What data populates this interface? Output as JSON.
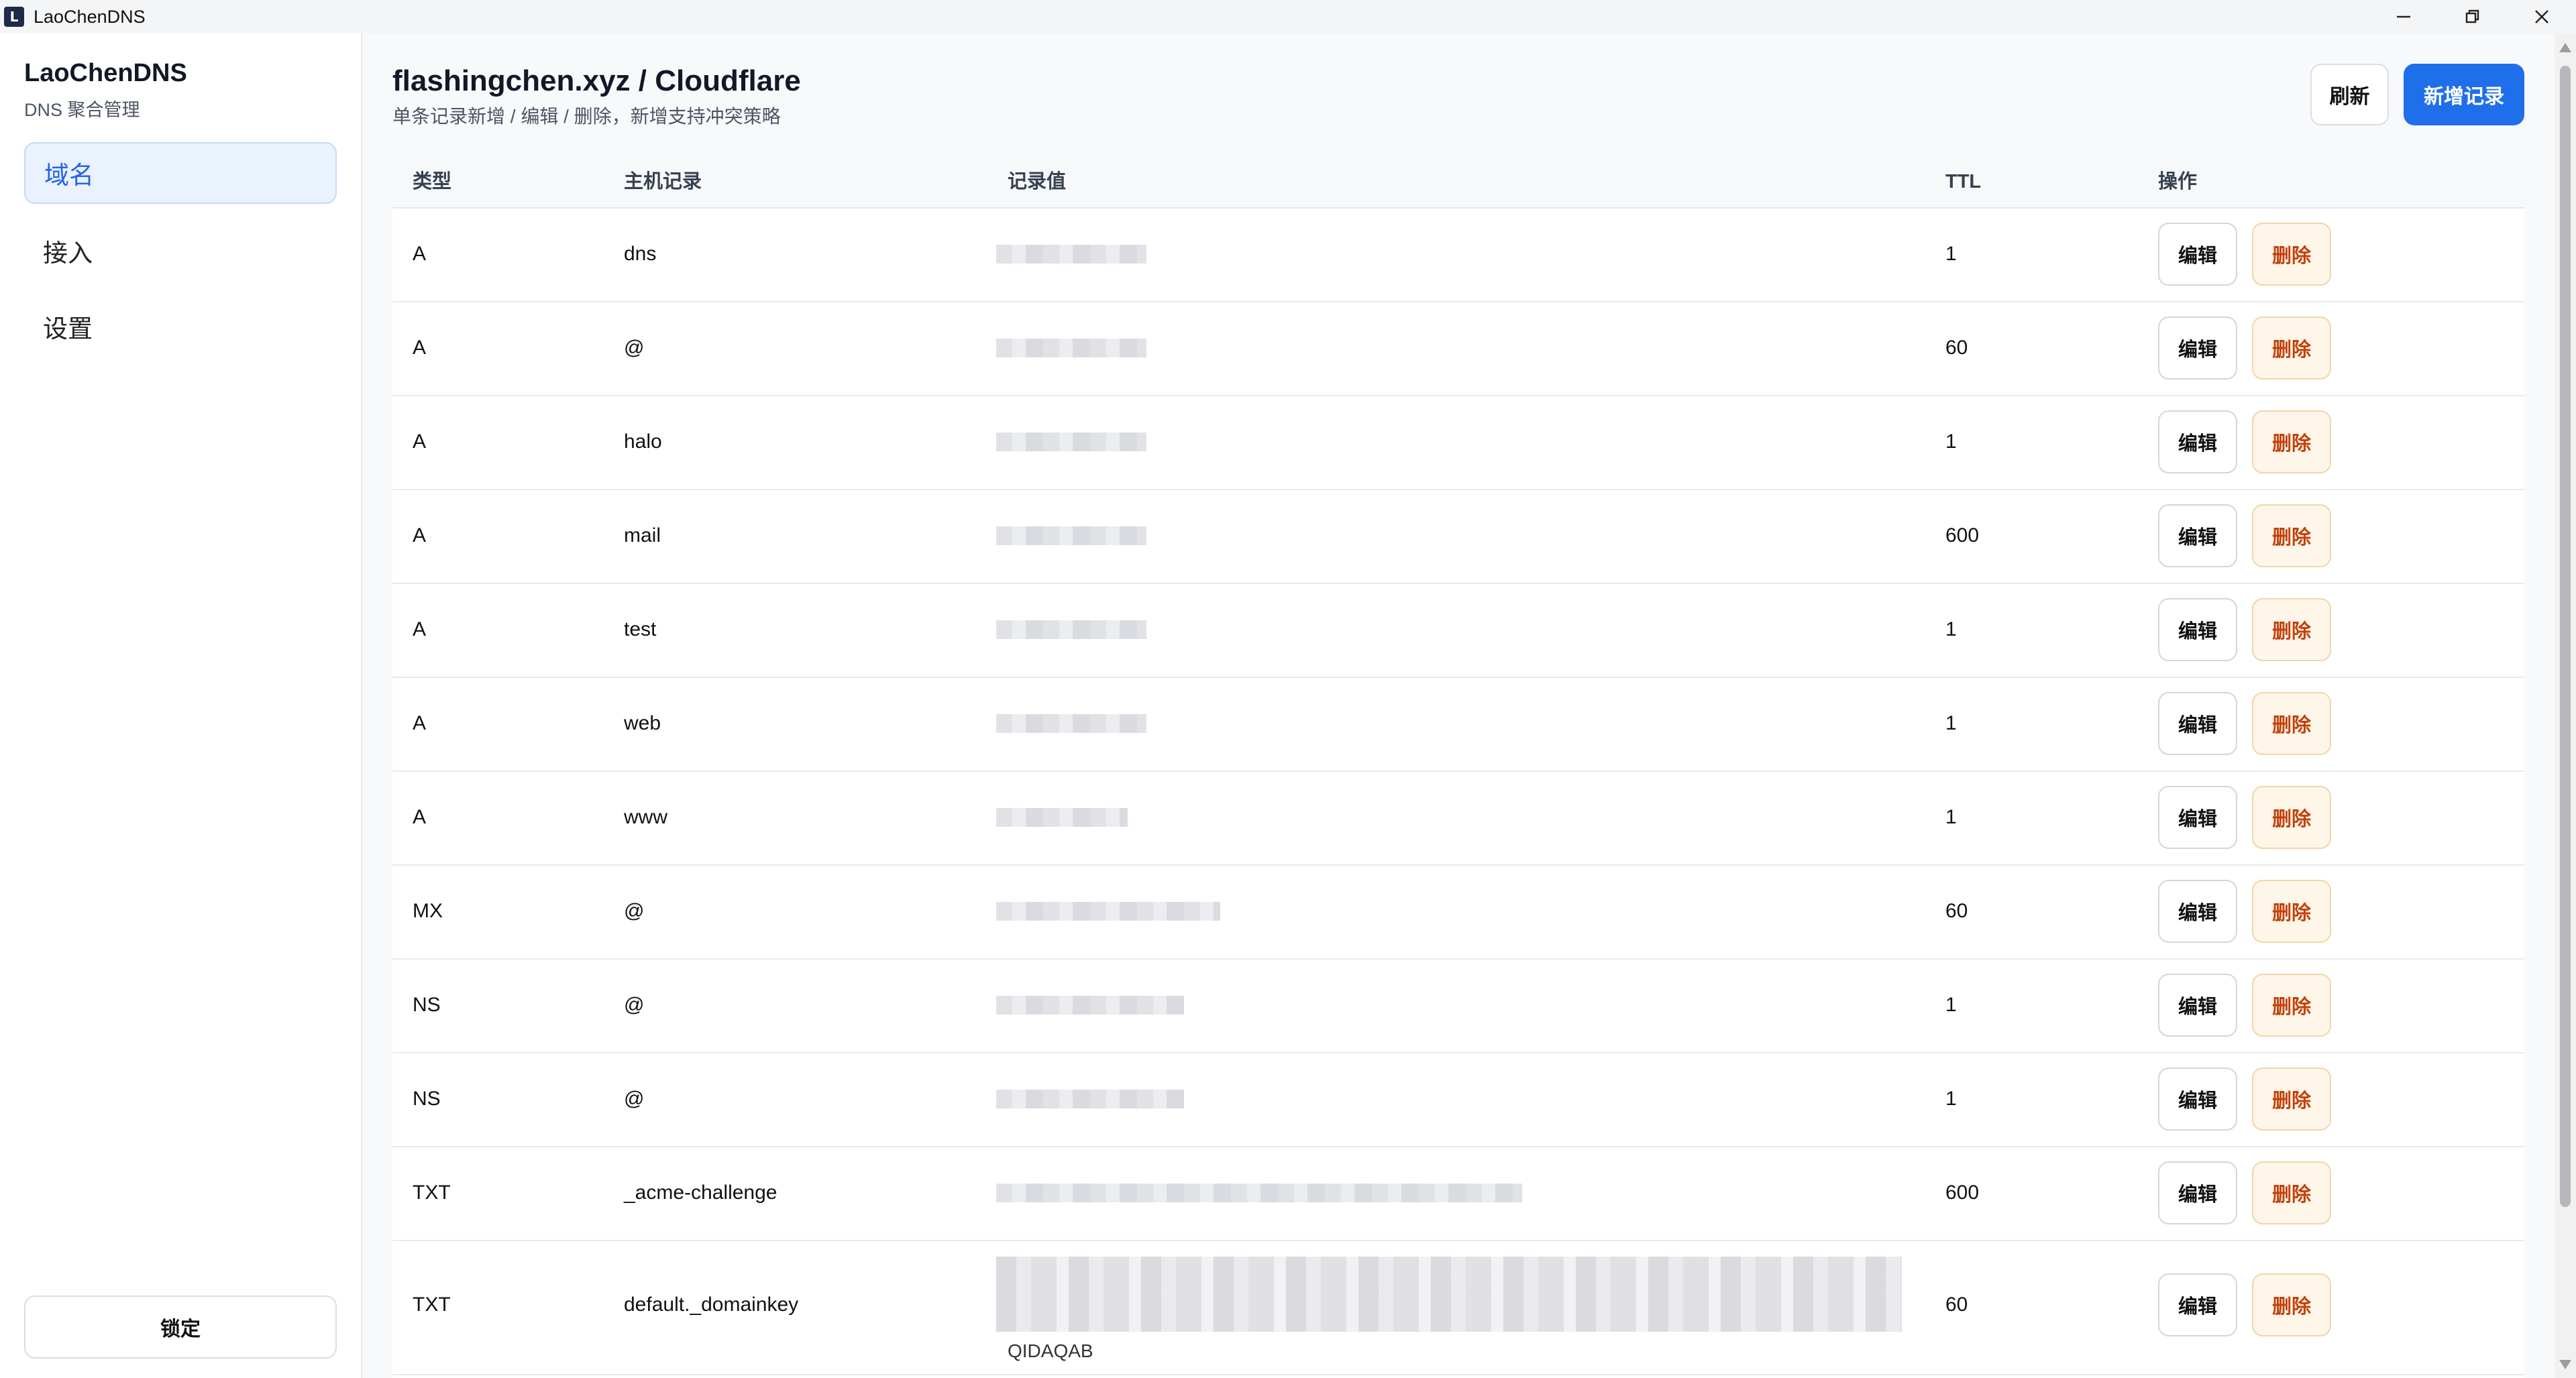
{
  "window": {
    "title": "LaoChenDNS",
    "app_icon_letter": "L"
  },
  "sidebar": {
    "brand": "LaoChenDNS",
    "subtitle": "DNS 聚合管理",
    "items": [
      {
        "label": "域名",
        "active": true
      },
      {
        "label": "接入",
        "active": false
      },
      {
        "label": "设置",
        "active": false
      }
    ],
    "lock_label": "锁定"
  },
  "header": {
    "title": "flashingchen.xyz / Cloudflare",
    "subtitle": "单条记录新增 / 编辑 / 删除，新增支持冲突策略",
    "refresh_label": "刷新",
    "add_label": "新增记录"
  },
  "table": {
    "columns": [
      "类型",
      "主机记录",
      "记录值",
      "TTL",
      "操作"
    ],
    "edit_label": "编辑",
    "delete_label": "删除",
    "rows": [
      {
        "type": "A",
        "host": "dns",
        "ttl": "1"
      },
      {
        "type": "A",
        "host": "@",
        "ttl": "60"
      },
      {
        "type": "A",
        "host": "halo",
        "ttl": "1"
      },
      {
        "type": "A",
        "host": "mail",
        "ttl": "600"
      },
      {
        "type": "A",
        "host": "test",
        "ttl": "1"
      },
      {
        "type": "A",
        "host": "web",
        "ttl": "1"
      },
      {
        "type": "A",
        "host": "www",
        "ttl": "1"
      },
      {
        "type": "MX",
        "host": "@",
        "ttl": "60"
      },
      {
        "type": "NS",
        "host": "@",
        "ttl": "1"
      },
      {
        "type": "NS",
        "host": "@",
        "ttl": "1"
      },
      {
        "type": "TXT",
        "host": "_acme-challenge",
        "ttl": "600"
      },
      {
        "type": "TXT",
        "host": "default._domainkey",
        "ttl": "60",
        "value_tail": "QIDAQAB"
      }
    ]
  },
  "colors": {
    "accent": "#1f6feb",
    "delete_text": "#c2410c",
    "delete_bg": "#fdf6e9",
    "active_nav_bg": "#eaf2ff"
  }
}
